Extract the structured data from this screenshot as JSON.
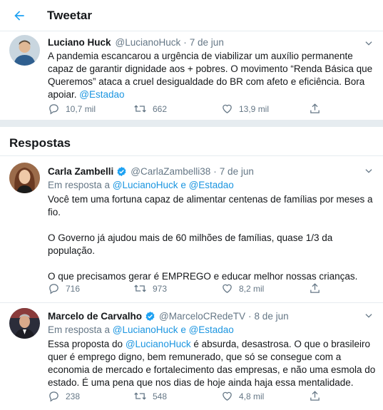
{
  "header": {
    "title": "Tweetar"
  },
  "main_tweet": {
    "name": "Luciano Huck",
    "handle": "@LucianoHuck",
    "date": "7 de jun",
    "text": "A pandemia escancarou a urgência de viabilizar um auxílio permanente capaz de garantir dignidade aos + pobres. O movimento “Renda Básica que Queremos” ataca a cruel desigualdade do BR com afeto e eficiência. Bora apoiar. ",
    "mention": "@Estadao",
    "replies": "10,7 mil",
    "retweets": "662",
    "likes": "13,9 mil"
  },
  "responses_section": {
    "title": "Respostas"
  },
  "replies": [
    {
      "name": "Carla Zambelli",
      "handle": "@CarlaZambelli38",
      "date": "7 de jun",
      "reply_prefix": "Em resposta a ",
      "reply_to_1": "@LucianoHuck",
      "reply_and": " e ",
      "reply_to_2": "@Estadao",
      "text": "Você tem uma fortuna capaz de alimentar centenas de famílias por meses a fio.\n\nO Governo já ajudou mais de 60 milhões de famílias, quase 1/3 da população.\n\nO que precisamos gerar é EMPREGO e educar melhor nossas crianças.",
      "replies": "716",
      "retweets": "973",
      "likes": "8,2 mil"
    },
    {
      "name": "Marcelo de Carvalho",
      "handle": "@MarceloCRedeTV",
      "date": "8 de jun",
      "reply_prefix": "Em resposta a ",
      "reply_to_1": "@LucianoHuck",
      "reply_and": " e ",
      "reply_to_2": "@Estadao",
      "text_before": "Essa proposta do ",
      "text_mention": "@LucianoHuck",
      "text_after": " é absurda, desastrosa. O que o brasileiro quer é emprego digno, bem remunerado, que só se consegue com a economia de mercado e fortalecimento das empresas, e não uma esmola do estado. É uma pena que nos dias de hoje ainda haja essa mentalidade.",
      "replies": "238",
      "retweets": "548",
      "likes": "4,8 mil"
    }
  ],
  "colors": {
    "accent": "#1da1f2",
    "link": "#1b95e0",
    "muted": "#657786",
    "retweet": "#17bf63",
    "divider": "#e6ecf0"
  }
}
